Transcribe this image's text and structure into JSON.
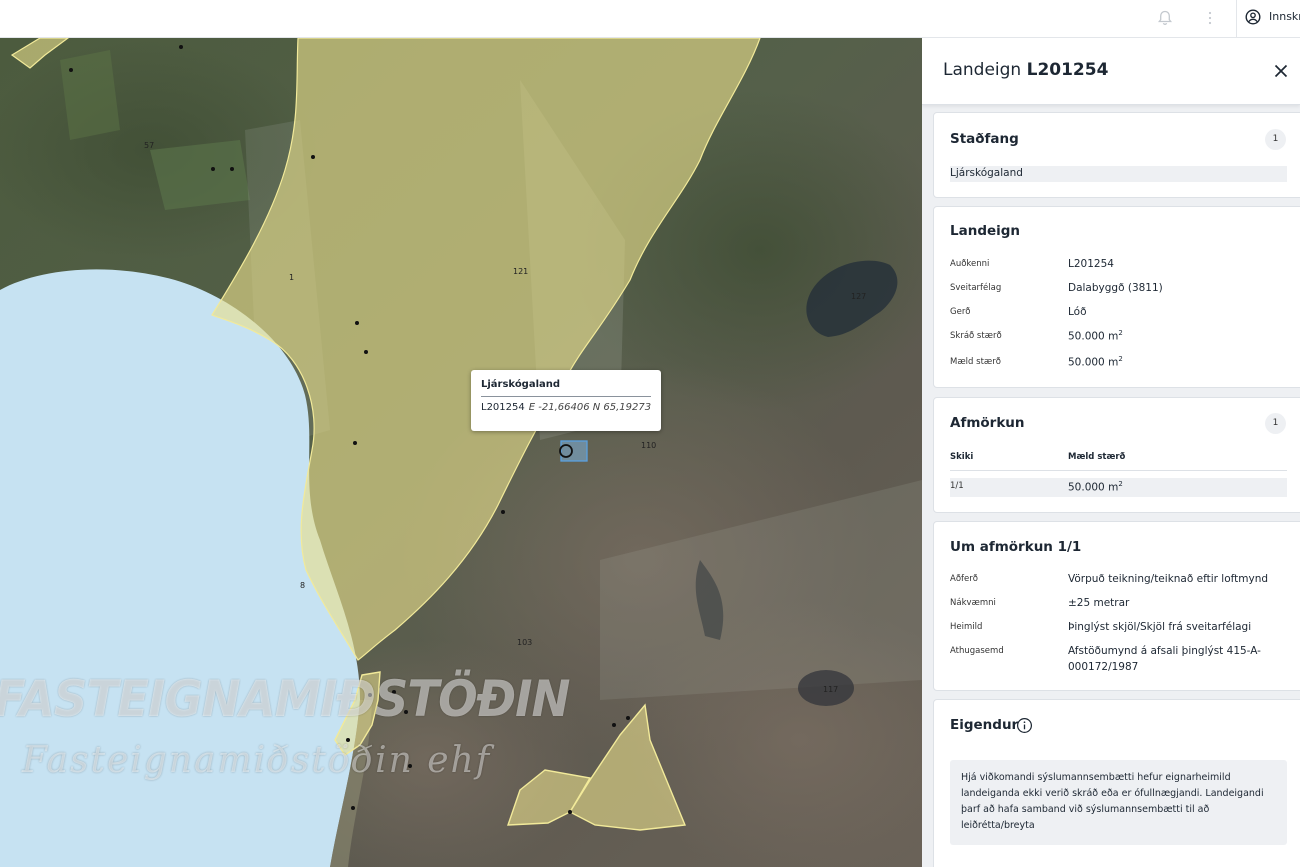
{
  "topbar": {
    "login_label": "Innskr",
    "icons": [
      "bell-icon",
      "more-vertical-icon",
      "user-circle-icon"
    ]
  },
  "map": {
    "popup": {
      "title": "Ljárskógaland",
      "id": "L201254",
      "coords": "E -21,66406  N 65,19273"
    },
    "labels": [
      "57",
      "121",
      "127",
      "110",
      "103",
      "117",
      "8",
      "1"
    ],
    "watermark": {
      "line1": "FASTEIGNAMIÐSTÖÐIN",
      "line2": "Fasteignamiðstöðin ehf"
    }
  },
  "panel": {
    "title_prefix": "Landeign",
    "title_id": "L201254",
    "stadfang": {
      "title": "Staðfang",
      "count": "1",
      "value": "Ljárskógaland"
    },
    "landeign": {
      "title": "Landeign",
      "rows": [
        {
          "key": "Auðkenni",
          "value": "L201254"
        },
        {
          "key": "Sveitarfélag",
          "value": "Dalabyggð (3811)"
        },
        {
          "key": "Gerð",
          "value": "Lóð"
        },
        {
          "key": "Skráð stærð",
          "value": "50.000 m"
        },
        {
          "key": "Mæld stærð",
          "value": "50.000 m"
        }
      ],
      "unit_sup": "2"
    },
    "afmorkun": {
      "title": "Afmörkun",
      "count": "1",
      "col1": "Skiki",
      "col2": "Mæld stærð",
      "row_key": "1/1",
      "row_value": "50.000 m",
      "unit_sup": "2"
    },
    "um_afmorkun": {
      "title": "Um afmörkun 1/1",
      "rows": [
        {
          "key": "Aðferð",
          "value": "Vörpuð teikning/teiknað eftir loftmynd"
        },
        {
          "key": "Nákvæmni",
          "value": "±25 metrar"
        },
        {
          "key": "Heimild",
          "value": "Þinglýst skjöl/Skjöl frá sveitarfélagi"
        },
        {
          "key": "Athugasemd",
          "value": "Afstöðumynd á afsali þinglýst 415-A-",
          "value2": "000172/1987"
        }
      ]
    },
    "eigendur": {
      "title": "Eigendur",
      "note_lines": [
        "Hjá viðkomandi sýslumannsembætti hefur eignarheimild",
        "landeiganda ekki verið skráð eða er ófullnægjandi. Landeigandi",
        "þarf að hafa samband við sýslumannsembætti til að",
        "leiðrétta/breyta"
      ]
    }
  }
}
